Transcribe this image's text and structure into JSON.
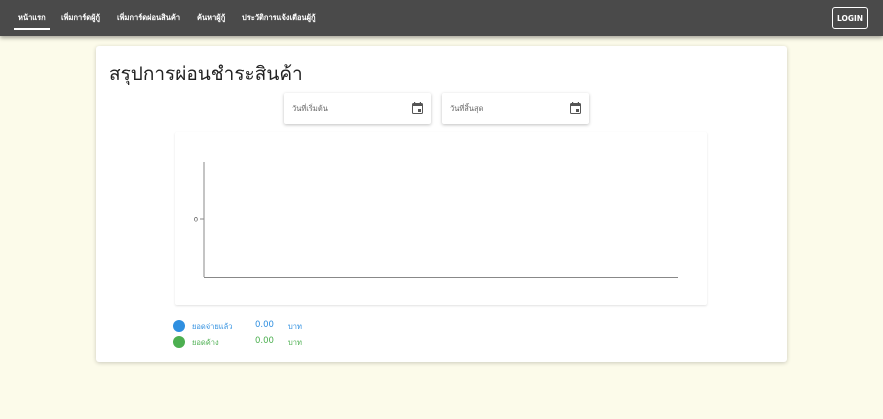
{
  "nav": {
    "items": [
      {
        "label": "หน้าแรก",
        "active": true
      },
      {
        "label": "เพิ่มการ์ดผู้กู้"
      },
      {
        "label": "เพิ่มการ์ดผ่อนสินค้า"
      },
      {
        "label": "ค้นหาผู้กู้"
      },
      {
        "label": "ประวัติการแจ้งเตือนผู้กู้"
      }
    ],
    "login_label": "LOGIN"
  },
  "page": {
    "title": "สรุปการผ่อนชำระสินค้า"
  },
  "filters": {
    "start_date_placeholder": "วันที่เริ่มต้น",
    "end_date_placeholder": "วันที่สิ้นสุด",
    "calendar_icon": "calendar-icon"
  },
  "chart_data": {
    "type": "line",
    "x": [],
    "series": [],
    "y_ticks": [
      "0"
    ],
    "title": "",
    "xlabel": "",
    "ylabel": ""
  },
  "summary": {
    "paid": {
      "label": "ยอดจ่ายแล้ว",
      "amount": "0.00",
      "unit": "บาท",
      "color": "#2f8fe0"
    },
    "outstanding": {
      "label": "ยอดค้าง",
      "amount": "0.00",
      "unit": "บาท",
      "color": "#4caf50"
    }
  },
  "colors": {
    "topbar": "#4a4a4a",
    "background": "#fcfbea",
    "paid_text": "#2f8fe0",
    "outstanding_text": "#4caf50"
  }
}
